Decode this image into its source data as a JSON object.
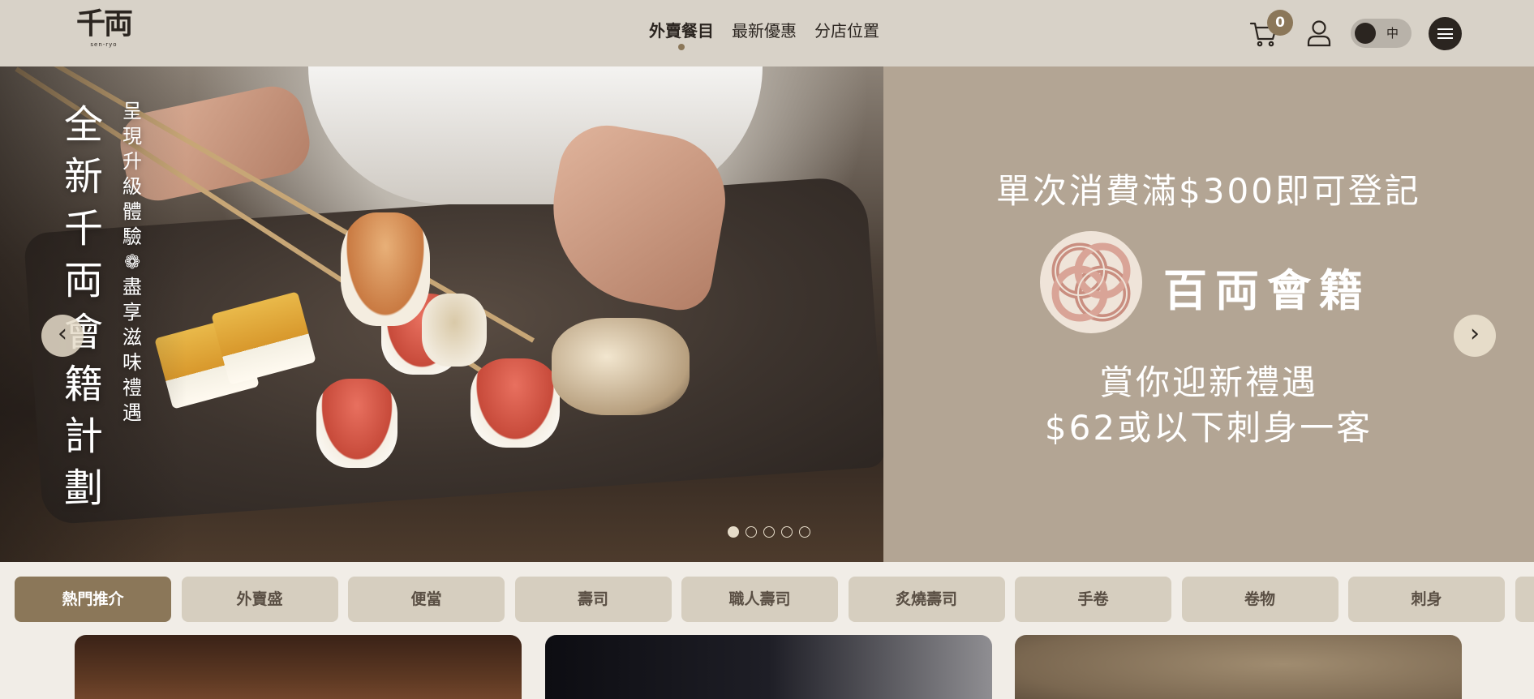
{
  "header": {
    "logo_text": "千両",
    "logo_sub": "sen-ryo",
    "nav": [
      {
        "label": "外賣餐目",
        "active": true
      },
      {
        "label": "最新優惠",
        "active": false
      },
      {
        "label": "分店位置",
        "active": false
      }
    ],
    "cart_count": "0",
    "language_toggle_label": "中",
    "icons": [
      "cart-icon",
      "user-icon",
      "menu-icon"
    ]
  },
  "hero": {
    "title_chars": [
      "全",
      "新",
      "千",
      "両",
      "會",
      "籍",
      "計",
      "劃"
    ],
    "subtitle_chars": [
      "呈",
      "現",
      "升",
      "級",
      "體",
      "驗",
      "❁",
      "盡",
      "享",
      "滋",
      "味",
      "禮",
      "遇"
    ],
    "promo_line1": "單次消費滿$300即可登記",
    "promo_brand": "百両會籍",
    "promo_line2": "賞你迎新禮遇",
    "promo_line3": "$62或以下刺身一客",
    "prev_label": "‹",
    "next_label": "›",
    "slide_count": 5,
    "active_slide": 1
  },
  "categories": [
    {
      "label": "熱門推介",
      "active": true
    },
    {
      "label": "外賣盛",
      "active": false
    },
    {
      "label": "便當",
      "active": false
    },
    {
      "label": "壽司",
      "active": false
    },
    {
      "label": "職人壽司",
      "active": false
    },
    {
      "label": "炙燒壽司",
      "active": false
    },
    {
      "label": "手卷",
      "active": false
    },
    {
      "label": "卷物",
      "active": false
    },
    {
      "label": "刺身",
      "active": false
    }
  ],
  "colors": {
    "header_bg": "#d8d2c8",
    "accent": "#8b7759",
    "panel_bg": "#b3a594",
    "category_bg": "#d6cebf"
  }
}
